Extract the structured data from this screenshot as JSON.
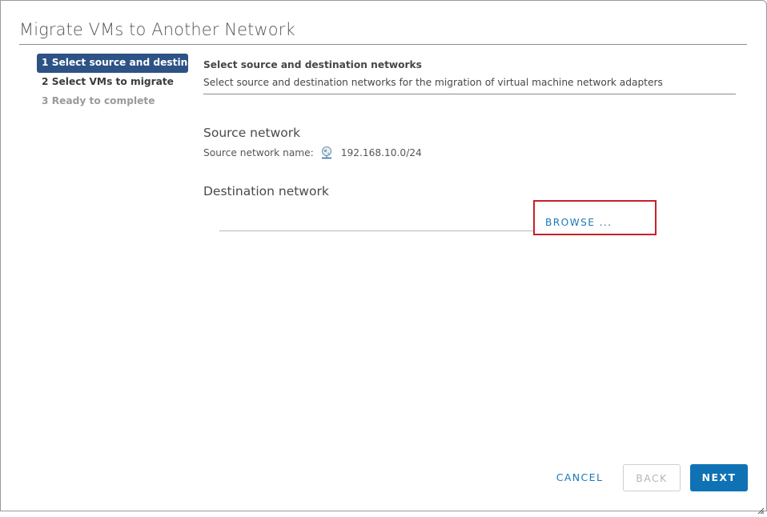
{
  "dialog": {
    "title": "Migrate VMs to Another Network"
  },
  "steps": [
    {
      "label": "1 Select source and destina...",
      "state": "active"
    },
    {
      "label": "2 Select VMs to migrate",
      "state": "enabled"
    },
    {
      "label": "3 Ready to complete",
      "state": "disabled"
    }
  ],
  "header": {
    "title": "Select source and destination networks",
    "description": "Select source and destination networks for the migration of virtual machine network adapters"
  },
  "source": {
    "section_title": "Source network",
    "name_label": "Source network name:",
    "icon": "network-icon",
    "name_value": "192.168.10.0/24"
  },
  "destination": {
    "section_title": "Destination network",
    "value": "",
    "browse_label": "BROWSE ..."
  },
  "footer": {
    "cancel_label": "CANCEL",
    "back_label": "BACK",
    "next_label": "NEXT"
  },
  "colors": {
    "active_step": "#2d5285",
    "primary": "#0f72b5",
    "link": "#1a78b8",
    "highlight_box": "#c8202a"
  }
}
